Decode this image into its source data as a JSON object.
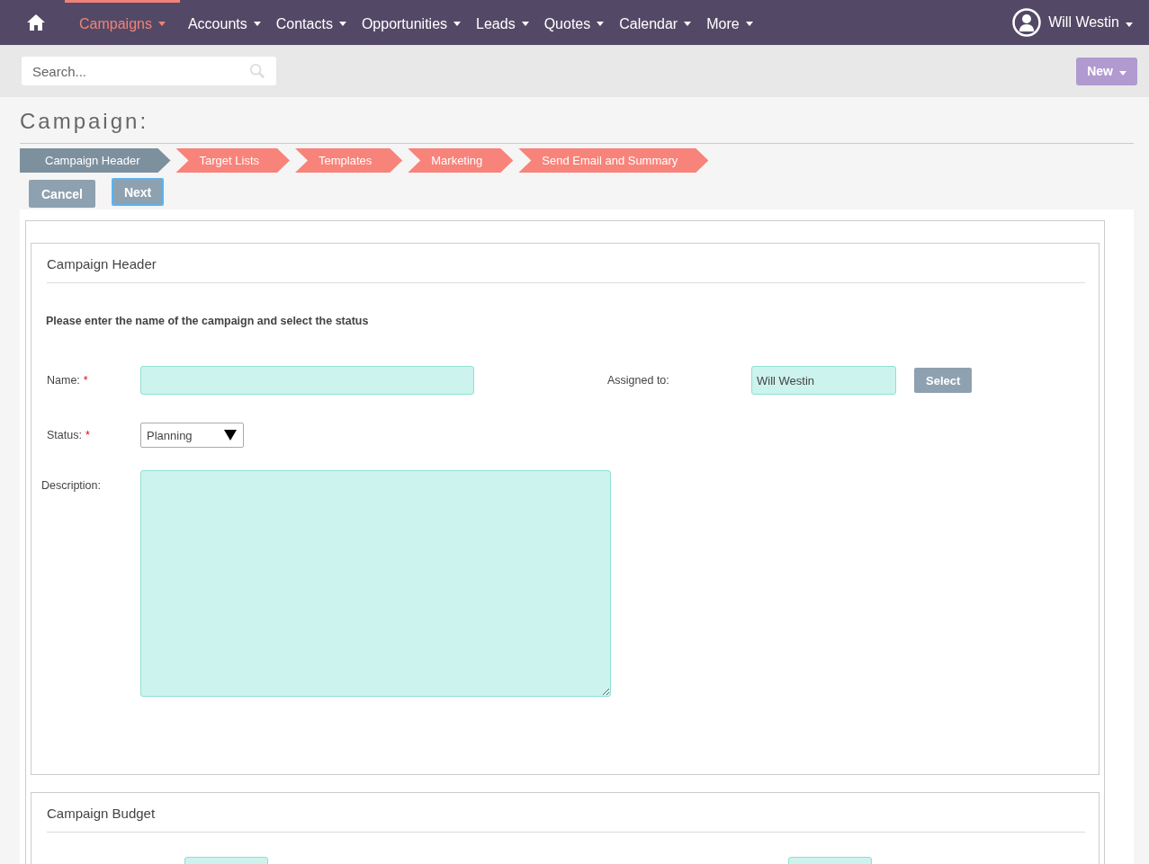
{
  "nav": {
    "items": [
      {
        "label": "Campaigns",
        "selected": true
      },
      {
        "label": "Accounts",
        "selected": false
      },
      {
        "label": "Contacts",
        "selected": false
      },
      {
        "label": "Opportunities",
        "selected": false
      },
      {
        "label": "Leads",
        "selected": false
      },
      {
        "label": "Quotes",
        "selected": false
      },
      {
        "label": "Calendar",
        "selected": false
      },
      {
        "label": "More",
        "selected": false
      }
    ],
    "user": "Will Westin"
  },
  "search": {
    "placeholder": "Search..."
  },
  "new_button": "New",
  "page_title": "Campaign:",
  "steps": [
    {
      "label": "Campaign Header",
      "selected": true
    },
    {
      "label": "Target Lists",
      "selected": false
    },
    {
      "label": "Templates",
      "selected": false
    },
    {
      "label": "Marketing",
      "selected": false
    },
    {
      "label": "Send Email and Summary",
      "selected": false
    }
  ],
  "actions": [
    {
      "label": "Cancel",
      "focused": false
    },
    {
      "label": "Next",
      "focused": true
    }
  ],
  "header_panel": {
    "title": "Campaign Header",
    "instructions": "Please enter the name of the campaign and select the status",
    "name": {
      "label": "Name:",
      "required_mark": "*"
    },
    "assigned": {
      "label": "Assigned to:",
      "value": "Will Westin",
      "button": "Select"
    },
    "status": {
      "label": "Status:",
      "required_mark": "*",
      "value": "Planning"
    },
    "description": {
      "label": "Description:"
    }
  },
  "budget_panel": {
    "title": "Campaign Budget"
  }
}
